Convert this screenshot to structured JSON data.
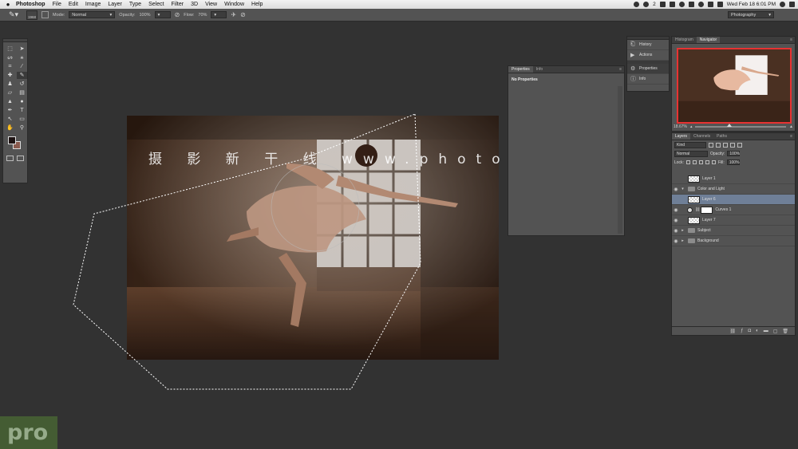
{
  "menubar": {
    "app": "Photoshop",
    "menus": [
      "File",
      "Edit",
      "Image",
      "Layer",
      "Type",
      "Select",
      "Filter",
      "3D",
      "View",
      "Window",
      "Help"
    ],
    "badge_count": "2",
    "datetime": "Wed Feb 18  6:01 PM"
  },
  "options": {
    "brush_size": "1968",
    "mode_label": "Mode:",
    "mode_value": "Normal",
    "opacity_label": "Opacity:",
    "opacity_value": "100%",
    "flow_label": "Flow:",
    "flow_value": "70%",
    "workspace": "Photography"
  },
  "watermark": "摄 影 新 干 线   www.photosks.vip",
  "properties": {
    "tabs": [
      "Properties",
      "Info"
    ],
    "message": "No Properties"
  },
  "dock": {
    "items": [
      "History",
      "Actions",
      "Properties",
      "Info"
    ]
  },
  "navigator": {
    "tabs": [
      "Histogram",
      "Navigator"
    ],
    "zoom": "18.67%"
  },
  "layers": {
    "tabs": [
      "Layers",
      "Channels",
      "Paths"
    ],
    "kind": "Kind",
    "blend_mode": "Normal",
    "opacity_label": "Opacity:",
    "opacity_value": "100%",
    "lock_label": "Lock:",
    "fill_label": "Fill:",
    "fill_value": "100%",
    "items": [
      {
        "name": "Layer 1"
      },
      {
        "name": "Color and Light"
      },
      {
        "name": "Layer 6"
      },
      {
        "name": "Curves 1"
      },
      {
        "name": "Layer 7"
      },
      {
        "name": "Subject"
      },
      {
        "name": "Background"
      }
    ]
  },
  "badge": "pro",
  "colors": {
    "foreground": "#1e1414",
    "background": "#8a5a4e",
    "selected_layer": "#6f7f97",
    "navigator_view_box": "#e83232"
  }
}
